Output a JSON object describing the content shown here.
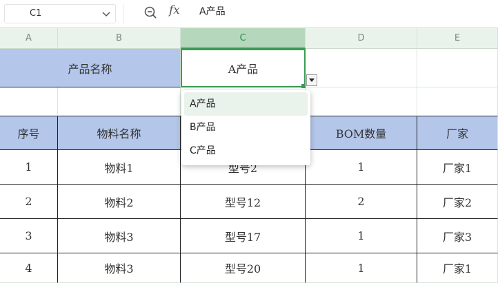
{
  "formula_bar": {
    "cell_ref": "C1",
    "fx_label": "fx",
    "formula_value": "A产品"
  },
  "columns": [
    "A",
    "B",
    "C",
    "D",
    "E"
  ],
  "selected_column": "C",
  "sheet": {
    "product_label": "产品名称",
    "product_value": "A产品",
    "table_headers": [
      "序号",
      "物料名称",
      "",
      "BOM数量",
      "厂家"
    ],
    "rows": [
      [
        "1",
        "物料1",
        "型号2",
        "1",
        "厂家1"
      ],
      [
        "2",
        "物料2",
        "型号12",
        "2",
        "厂家2"
      ],
      [
        "3",
        "物料3",
        "型号17",
        "1",
        "厂家3"
      ],
      [
        "4",
        "物料3",
        "型号20",
        "1",
        "厂家1"
      ]
    ]
  },
  "dropdown": {
    "options": [
      "A产品",
      "B产品",
      "C产品"
    ],
    "highlighted_index": 0
  },
  "colors": {
    "header_fill": "#b4c6e9",
    "selection_green": "#3c9a54",
    "column_header_bg": "#e9f3eb"
  }
}
